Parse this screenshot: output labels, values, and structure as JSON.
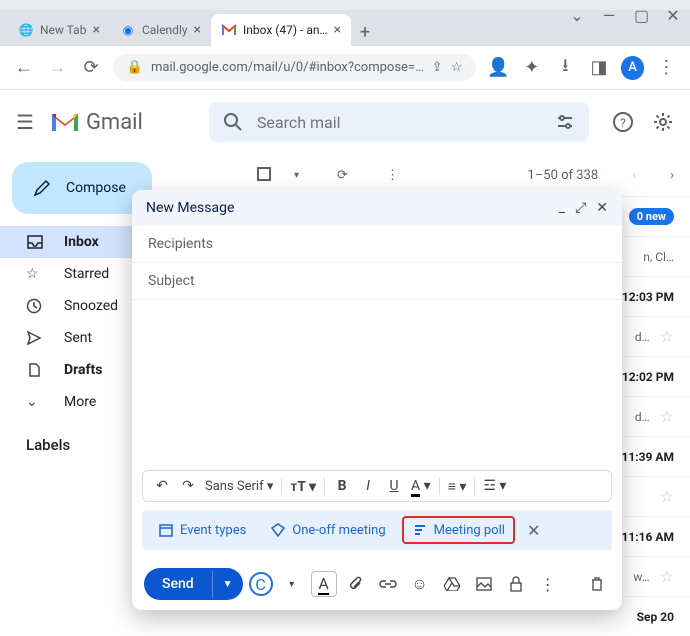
{
  "window": {
    "controls": [
      "⌄",
      "—",
      "▢",
      "✕"
    ]
  },
  "tabs": [
    {
      "title": "New Tab",
      "favicon": "globe"
    },
    {
      "title": "Calendly",
      "favicon": "calendly"
    },
    {
      "title": "Inbox (47) - an…",
      "favicon": "gmail",
      "active": true
    }
  ],
  "toolbar": {
    "url": "mail.google.com/mail/u/0/#inbox?compose=…",
    "avatar_letter": "A"
  },
  "gmail": {
    "brand": "Gmail",
    "search_placeholder": "Search mail"
  },
  "sidebar": {
    "compose": "Compose",
    "items": [
      {
        "icon": "inbox",
        "label": "Inbox",
        "active": true
      },
      {
        "icon": "star",
        "label": "Starred"
      },
      {
        "icon": "clock",
        "label": "Snoozed"
      },
      {
        "icon": "send",
        "label": "Sent"
      },
      {
        "icon": "file",
        "label": "Drafts",
        "bold": true
      },
      {
        "icon": "chev",
        "label": "More"
      }
    ],
    "labels_header": "Labels"
  },
  "list": {
    "range": "1–50 of 338",
    "rows": [
      {
        "badge": "0 new",
        "tail": "n, Cl…"
      },
      {
        "time": "12:03 PM",
        "tail": "d…"
      },
      {
        "time": "12:02 PM",
        "tail": "d…"
      },
      {
        "time": "11:39 AM"
      },
      {
        "time": "11:16 AM",
        "tail": "w…"
      },
      {
        "time": "Sep 20"
      }
    ]
  },
  "compose": {
    "title": "New Message",
    "recipients": "Recipients",
    "subject": "Subject",
    "font": "Sans Serif",
    "calendly": {
      "event_types": "Event types",
      "one_off": "One-off meeting",
      "meeting_poll": "Meeting poll"
    },
    "send": "Send"
  }
}
